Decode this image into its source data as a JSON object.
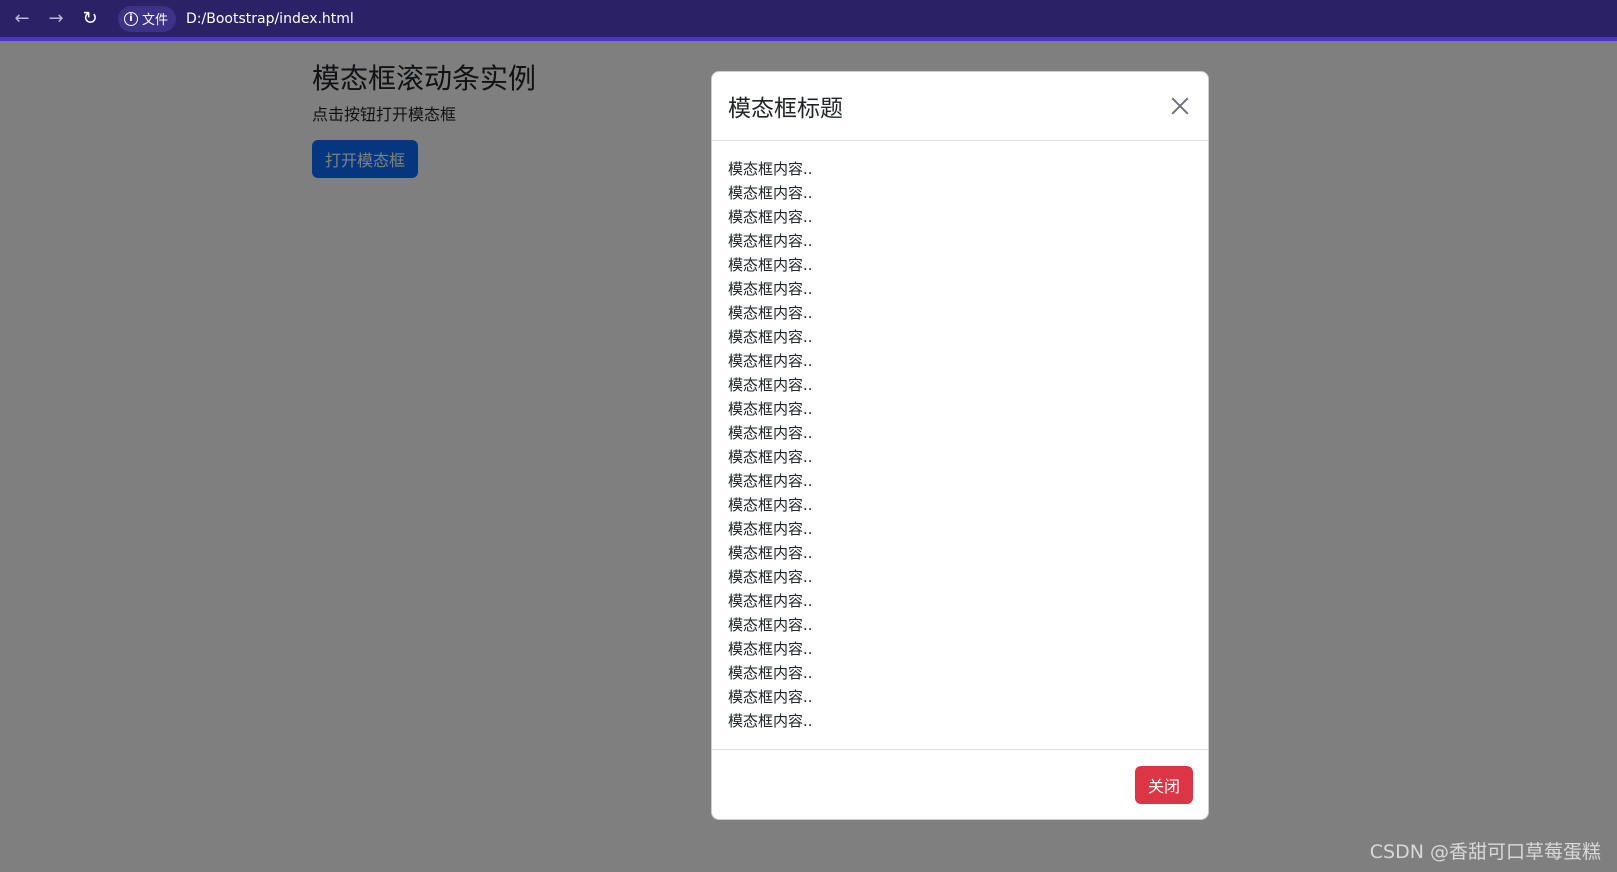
{
  "browser": {
    "back_icon": "←",
    "forward_icon": "→",
    "reload_icon": "↻",
    "site_label": "文件",
    "url": "D:/Bootstrap/index.html"
  },
  "page": {
    "title": "模态框滚动条实例",
    "subtitle": "点击按钮打开模态框",
    "open_button": "打开模态框"
  },
  "modal": {
    "title": "模态框标题",
    "body_lines": [
      "模态框内容..",
      "模态框内容..",
      "模态框内容..",
      "模态框内容..",
      "模态框内容..",
      "模态框内容..",
      "模态框内容..",
      "模态框内容..",
      "模态框内容..",
      "模态框内容..",
      "模态框内容..",
      "模态框内容..",
      "模态框内容..",
      "模态框内容..",
      "模态框内容..",
      "模态框内容..",
      "模态框内容..",
      "模态框内容..",
      "模态框内容..",
      "模态框内容..",
      "模态框内容..",
      "模态框内容..",
      "模态框内容..",
      "模态框内容.."
    ],
    "close_button": "关闭"
  },
  "watermark": "CSDN @香甜可口草莓蛋糕",
  "colors": {
    "primary": "#0d6efd",
    "danger": "#dc3545",
    "browser_bar": "#2b2166"
  }
}
